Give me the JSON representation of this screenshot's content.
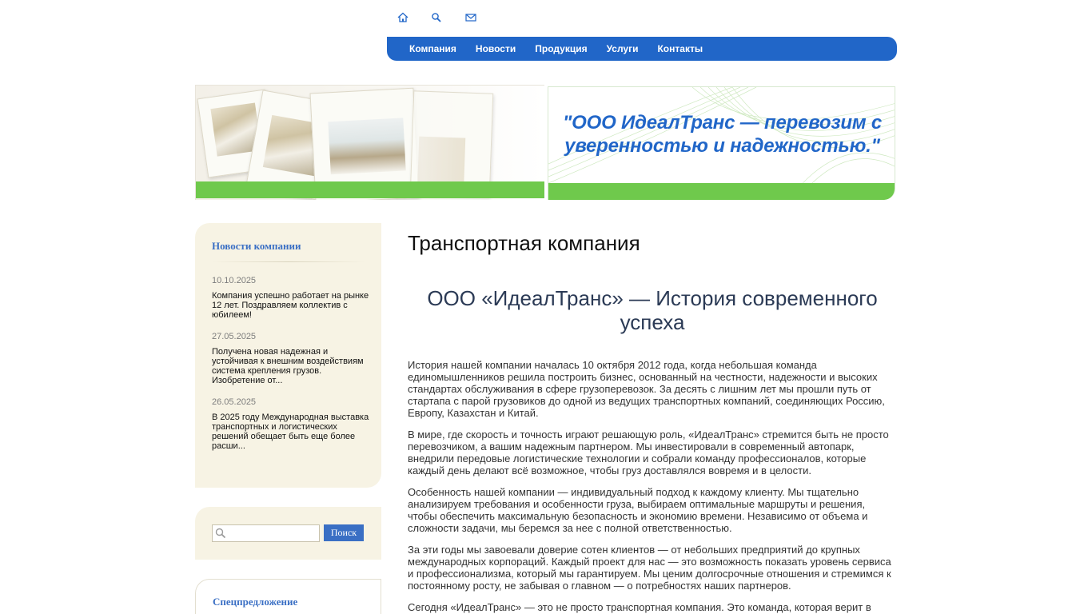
{
  "top_icons": [
    "home-icon",
    "search-icon",
    "mail-icon"
  ],
  "nav": {
    "items": [
      "Компания",
      "Новости",
      "Продукция",
      "Услуги",
      "Контакты"
    ]
  },
  "banner": {
    "slogan": "\"ООО ИдеалТранс — перевозим с уверенностью и надежностью.\""
  },
  "news": {
    "title": "Новости компании",
    "items": [
      {
        "date": "10.10.2025",
        "text": "Компания успешно работает на рынке 12 лет. Поздравляем коллектив с юбилеем!"
      },
      {
        "date": "27.05.2025",
        "text": "Получена новая надежная и устойчивая к внешним воздействиям система крепления грузов. Изобретение от..."
      },
      {
        "date": "26.05.2025",
        "text": "В 2025 году Международная выставка транспортных и логистических решений обещает быть еще более расши..."
      }
    ]
  },
  "search": {
    "placeholder": "",
    "button_label": "Поиск"
  },
  "special": {
    "title": "Спецпредложение"
  },
  "main": {
    "title": "Транспортная компания",
    "subtitle": "ООО «ИдеалТранс» — История современного успеха",
    "paragraphs": [
      "История нашей компании началась 10 октября 2012 года, когда небольшая команда единомышленников решила построить бизнес, основанный на честности, надежности и высоких стандартах обслуживания в сфере грузоперевозок. За десять с лишним лет мы прошли путь от стартапа с парой грузовиков до одной из ведущих транспортных компаний, соединяющих Россию, Европу, Казахстан и Китай.",
      "В мире, где скорость и точность играют решающую роль, «ИдеалТранс» стремится быть не просто перевозчиком, а вашим надежным партнером. Мы инвестировали в современный автопарк, внедрили передовые логистические технологии и собрали команду профессионалов, которые каждый день делают всё возможное, чтобы груз доставлялся вовремя и в целости.",
      "Особенность нашей компании — индивидуальный подход к каждому клиенту. Мы тщательно анализируем требования и особенности груза, выбираем оптимальные маршруты и решения, чтобы обеспечить максимальную безопасность и экономию времени. Независимо от объема и сложности задачи, мы беремся за нее с полной ответственностью.",
      "За эти годы мы завоевали доверие сотен клиентов — от небольших предприятий до крупных международных корпораций. Каждый проект для нас — это возможность показать уровень сервиса и профессионализма, который мы гарантируем. Мы ценим долгосрочные отношения и стремимся к постоянному росту, не забывая о главном — о потребностях наших партнеров.",
      "Сегодня «ИдеалТранс» — это не просто транспортная компания. Это команда, которая верит в"
    ]
  },
  "colors": {
    "accent": "#2166c8",
    "green": "#6fc94c",
    "sidebar_bg": "#f7f3e4",
    "link": "#3a6fc4"
  }
}
